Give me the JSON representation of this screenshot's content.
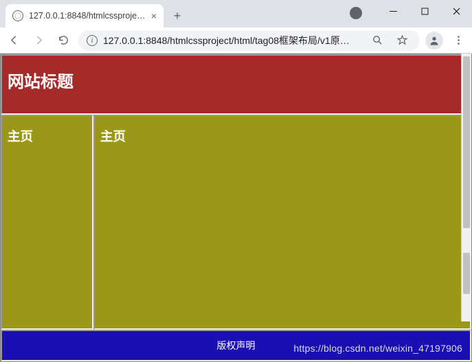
{
  "browser": {
    "tab_title": "127.0.0.1:8848/htmlcssproject/",
    "url": "127.0.0.1:8848/htmlcssproject/html/tag08框架布局/v1原…"
  },
  "page": {
    "site_title": "网站标题",
    "nav_heading": "主页",
    "main_heading": "主页",
    "footer_text": "版权声明"
  },
  "watermark": "https://blog.csdn.net/weixin_47197906"
}
